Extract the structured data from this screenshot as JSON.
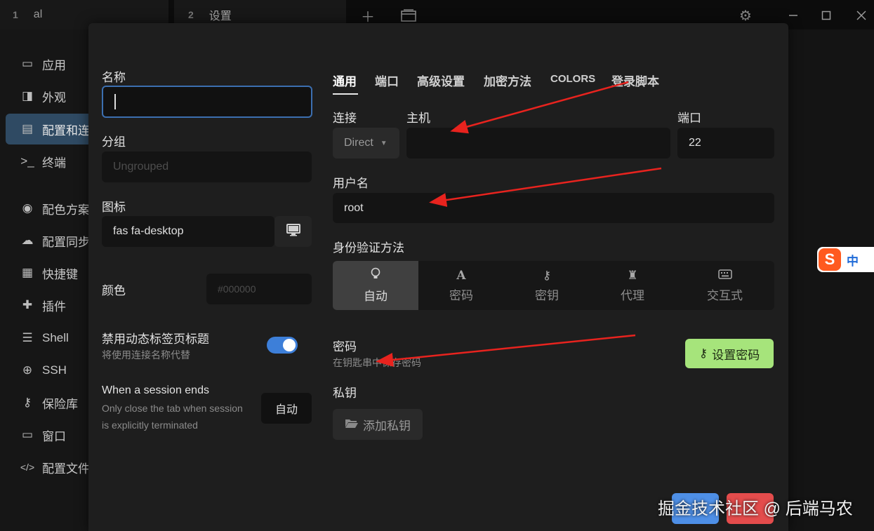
{
  "titlebar": {
    "tabs": [
      {
        "num": "1",
        "label": "al"
      },
      {
        "num": "2",
        "label": "设置"
      }
    ]
  },
  "sidebar": {
    "items": [
      {
        "label": "应用",
        "icon": "▭"
      },
      {
        "label": "外观",
        "icon": "◨"
      },
      {
        "label": "配置和连",
        "icon": "▤"
      },
      {
        "label": "终端",
        "icon": ">_"
      },
      {
        "label": "配色方案",
        "icon": "◉"
      },
      {
        "label": "配置同步",
        "icon": "☁"
      },
      {
        "label": "快捷键",
        "icon": "▦"
      },
      {
        "label": "插件",
        "icon": "✚"
      },
      {
        "label": "Shell",
        "icon": "☰"
      },
      {
        "label": "SSH",
        "icon": "⊕"
      },
      {
        "label": "保险库",
        "icon": "⚷"
      },
      {
        "label": "窗口",
        "icon": "▭"
      },
      {
        "label": "配置文件",
        "icon": "</>"
      }
    ]
  },
  "left": {
    "name_label": "名称",
    "group_label": "分组",
    "group_placeholder": "Ungrouped",
    "icon_label": "图标",
    "icon_value": "fas fa-desktop",
    "color_label": "颜色",
    "color_placeholder": "#000000",
    "disable_title_label": "禁用动态标签页标题",
    "disable_title_hint": "将使用连接名称代替",
    "disable_title_on": true,
    "session_end_label": "When a session ends",
    "session_end_hint_1": "Only close the tab when session",
    "session_end_hint_2": "is explicitly terminated",
    "session_end_value": "自动"
  },
  "tabs": [
    "通用",
    "端口",
    "高级设置",
    "加密方法",
    "COLORS",
    "登录脚本"
  ],
  "general": {
    "connection_label": "连接",
    "connection_value": "Direct",
    "host_label": "主机",
    "host_value": "",
    "port_label": "端口",
    "port_value": "22",
    "username_label": "用户名",
    "username_value": "root",
    "auth_label": "身份验证方法",
    "auth_options": [
      {
        "label": "自动",
        "icon": "lightbulb-icon"
      },
      {
        "label": "密码",
        "icon": "font-icon"
      },
      {
        "label": "密钥",
        "icon": "key-icon"
      },
      {
        "label": "代理",
        "icon": "agent-icon"
      },
      {
        "label": "交互式",
        "icon": "keyboard-icon"
      }
    ],
    "password_label": "密码",
    "password_hint": "在钥匙串中保存密码",
    "set_password_button": "设置密码",
    "private_key_label": "私钥",
    "add_key_button": "添加私钥"
  },
  "ime": {
    "brand": "S",
    "mode": "中"
  },
  "watermark": "掘金技术社区 @ 后端马农",
  "colors": {
    "accent": "#3d7fd9",
    "green": "#a6e47b",
    "active_side": "#2f4a63",
    "arrow": "#e8231e"
  }
}
